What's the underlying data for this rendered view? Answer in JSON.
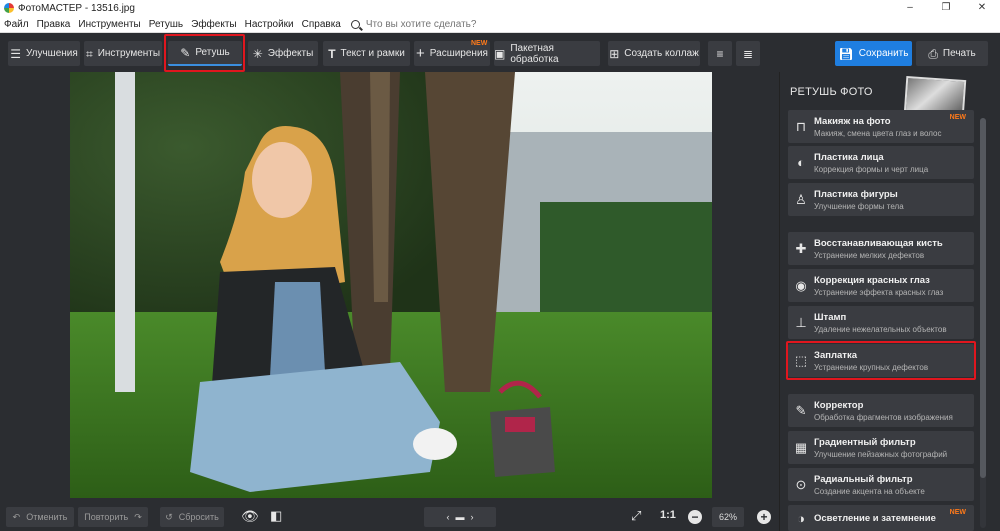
{
  "window": {
    "title": "ФотоМАСТЕР - 13516.jpg",
    "minimize": "–",
    "maximize": "❐",
    "close": "✕"
  },
  "menu": {
    "items": [
      "Файл",
      "Правка",
      "Инструменты",
      "Ретушь",
      "Эффекты",
      "Настройки",
      "Справка"
    ],
    "search_placeholder": "Что вы хотите сделать?"
  },
  "toolbar": {
    "tabs": [
      {
        "label": "Улучшения",
        "icon": "sliders-icon"
      },
      {
        "label": "Инструменты",
        "icon": "crop-icon"
      },
      {
        "label": "Ретушь",
        "icon": "brush-icon",
        "active": true
      },
      {
        "label": "Эффекты",
        "icon": "sparkle-icon"
      },
      {
        "label": "Текст и рамки",
        "icon": "text-icon"
      },
      {
        "label": "Расширения",
        "icon": "plus-icon",
        "badge": "NEW"
      },
      {
        "label": "Пакетная обработка",
        "icon": "image-icon"
      },
      {
        "label": "Создать коллаж",
        "icon": "grid-icon"
      }
    ],
    "save_label": "Сохранить",
    "print_label": "Печать"
  },
  "panel": {
    "title": "РЕТУШЬ ФОТО",
    "tools": [
      {
        "name": "Макияж на фото",
        "desc": "Макияж, смена цвета глаз и волос",
        "badge": "NEW",
        "icon": "makeup-icon"
      },
      {
        "name": "Пластика лица",
        "desc": "Коррекция формы и черт лица",
        "icon": "face-icon"
      },
      {
        "name": "Пластика фигуры",
        "desc": "Улучшение формы тела",
        "icon": "body-icon"
      },
      {
        "name": "Восстанавливающая кисть",
        "desc": "Устранение мелких дефектов",
        "icon": "bandage-icon"
      },
      {
        "name": "Коррекция красных глаз",
        "desc": "Устранение эффекта красных глаз",
        "icon": "eye-icon"
      },
      {
        "name": "Штамп",
        "desc": "Удаление нежелательных объектов",
        "icon": "stamp-icon"
      },
      {
        "name": "Заплатка",
        "desc": "Устранение крупных дефектов",
        "icon": "patch-icon",
        "highlighted": true
      },
      {
        "name": "Корректор",
        "desc": "Обработка фрагментов изображения",
        "icon": "corrector-brush-icon"
      },
      {
        "name": "Градиентный фильтр",
        "desc": "Улучшение пейзажных фотографий",
        "icon": "gradient-icon"
      },
      {
        "name": "Радиальный фильтр",
        "desc": "Создание акцента на объекте",
        "icon": "radial-icon"
      },
      {
        "name": "Осветление и затемнение",
        "desc": "",
        "badge": "NEW",
        "icon": "dodge-burn-icon"
      }
    ]
  },
  "bottom": {
    "undo_label": "Отменить",
    "redo_label": "Повторить",
    "reset_label": "Сбросить",
    "zoom_1to1": "1:1",
    "zoom_value": "62%"
  },
  "colors": {
    "accent": "#1f7ee0",
    "highlight_outline": "#e0161e",
    "new_badge": "#ff7a1a"
  }
}
